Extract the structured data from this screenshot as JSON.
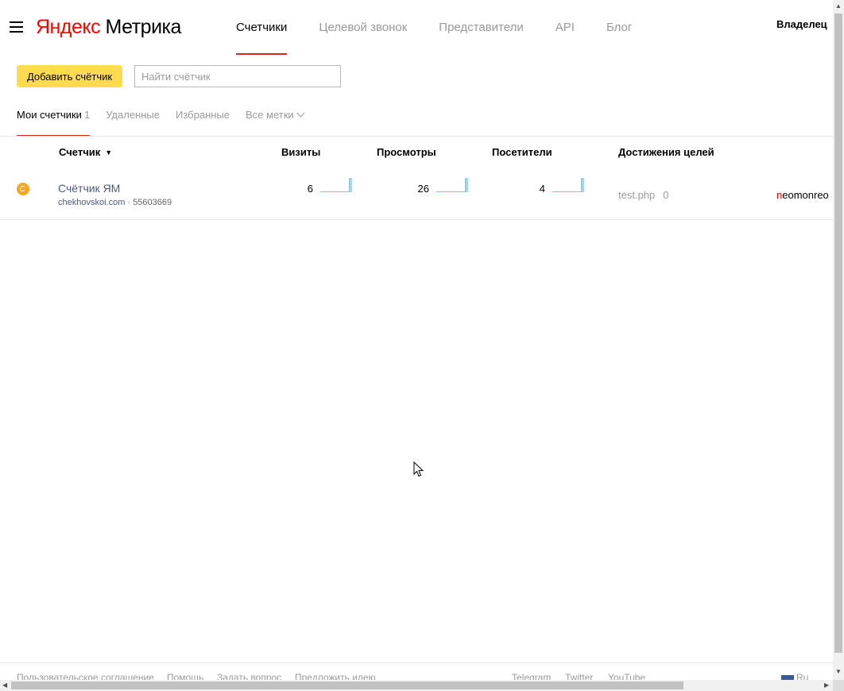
{
  "header": {
    "logo_yandex": "Яндекс",
    "logo_product": "Метрика",
    "nav": [
      {
        "label": "Счетчики",
        "active": true
      },
      {
        "label": "Целевой звонок",
        "active": false
      },
      {
        "label": "Представители",
        "active": false
      },
      {
        "label": "API",
        "active": false
      },
      {
        "label": "Блог",
        "active": false
      }
    ]
  },
  "toolbar": {
    "add_label": "Добавить счётчик",
    "search_placeholder": "Найти счётчик",
    "search_value": ""
  },
  "tabs": [
    {
      "label": "Мои счетчики",
      "count": "1",
      "active": true
    },
    {
      "label": "Удаленные",
      "active": false
    },
    {
      "label": "Избранные",
      "active": false
    },
    {
      "label": "Все метки",
      "active": false
    }
  ],
  "table": {
    "headers": {
      "counter": "Счетчик",
      "sort_indicator": "▼",
      "visits": "Визиты",
      "views": "Просмотры",
      "visitors": "Посетители",
      "goals": "Достижения целей",
      "owner": "Владелец"
    },
    "rows": [
      {
        "status_icon": "status-pending-icon",
        "name": "Счётчик ЯМ",
        "site": "chekhovskoi.com",
        "separator": " · ",
        "id": "55603669",
        "visits": "6",
        "views": "26",
        "visitors": "4",
        "goal_name": "test.php",
        "goal_count": "0",
        "owner_first": "n",
        "owner_rest": "eomonreo"
      }
    ]
  },
  "footer": {
    "links": [
      "Пользовательское соглашение",
      "Помощь",
      "Задать вопрос",
      "Предложить идею"
    ],
    "social": [
      "Telegram",
      "Twitter",
      "YouTube"
    ],
    "lang": "Ru"
  },
  "colors": {
    "accent_red": "#d7271d",
    "button_yellow": "#ffdb4d",
    "status_orange": "#f5a623",
    "link_blue": "#4b5a82",
    "sparkline": "#6cc4ef"
  }
}
